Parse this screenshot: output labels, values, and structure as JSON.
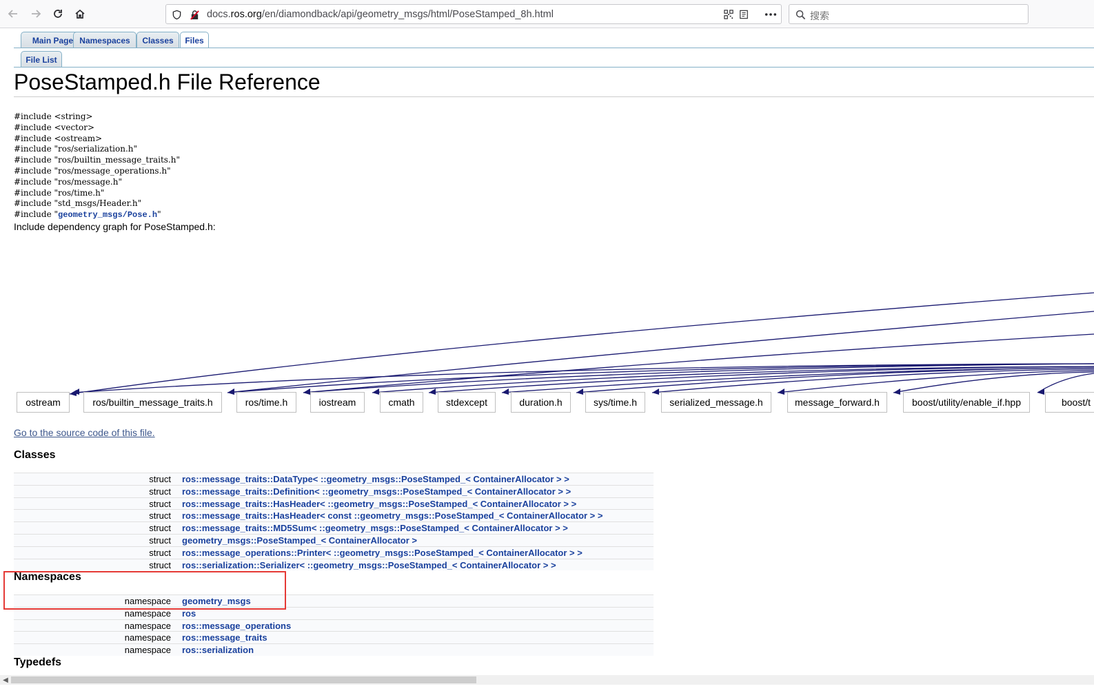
{
  "browser": {
    "url_prefix": "docs.",
    "url_host": "ros.org",
    "url_path": "/en/diamondback/api/geometry_msgs/html/PoseStamped_8h.html",
    "search_placeholder": "搜索",
    "icons": {
      "back": "arrow-left-icon",
      "forward": "arrow-right-icon",
      "reload": "reload-icon",
      "home": "home-icon",
      "shield": "shield-icon",
      "insecure": "insecure-lock-icon",
      "qr": "qr-code-icon",
      "reader": "reader-view-icon",
      "more": "more-icon",
      "search": "search-icon"
    }
  },
  "tabs": {
    "main_page": "Main Page",
    "namespaces": "Namespaces",
    "classes": "Classes",
    "files": "Files",
    "file_list": "File List"
  },
  "title": "PoseStamped.h File Reference",
  "includes": [
    "#include <string>",
    "#include <vector>",
    "#include <ostream>",
    "#include \"ros/serialization.h\"",
    "#include \"ros/builtin_message_traits.h\"",
    "#include \"ros/message_operations.h\"",
    "#include \"ros/message.h\"",
    "#include \"ros/time.h\"",
    "#include \"std_msgs/Header.h\""
  ],
  "include_link_prefix": "#include \"",
  "include_link": "geometry_msgs/Pose.h",
  "include_link_suffix": "\"",
  "dep_caption": "Include dependency graph for PoseStamped.h:",
  "graph_nodes": [
    "ostream",
    "ros/builtin_message_traits.h",
    "ros/time.h",
    "iostream",
    "cmath",
    "stdexcept",
    "duration.h",
    "sys/time.h",
    "serialized_message.h",
    "message_forward.h",
    "boost/utility/enable_if.hpp",
    "boost/t"
  ],
  "source_link": "Go to the source code of this file.",
  "sections": {
    "classes": "Classes",
    "namespaces": "Namespaces",
    "typedefs": "Typedefs"
  },
  "classes": [
    {
      "kind": "struct",
      "name": "ros::message_traits::DataType< ::geometry_msgs::PoseStamped_< ContainerAllocator > >"
    },
    {
      "kind": "struct",
      "name": "ros::message_traits::Definition< ::geometry_msgs::PoseStamped_< ContainerAllocator > >"
    },
    {
      "kind": "struct",
      "name": "ros::message_traits::HasHeader< ::geometry_msgs::PoseStamped_< ContainerAllocator > >"
    },
    {
      "kind": "struct",
      "name": "ros::message_traits::HasHeader< const ::geometry_msgs::PoseStamped_< ContainerAllocator > >"
    },
    {
      "kind": "struct",
      "name": "ros::message_traits::MD5Sum< ::geometry_msgs::PoseStamped_< ContainerAllocator > >"
    },
    {
      "kind": "struct",
      "name": "geometry_msgs::PoseStamped_< ContainerAllocator >"
    },
    {
      "kind": "struct",
      "name": "ros::message_operations::Printer< ::geometry_msgs::PoseStamped_< ContainerAllocator > >"
    },
    {
      "kind": "struct",
      "name": "ros::serialization::Serializer< ::geometry_msgs::PoseStamped_< ContainerAllocator > >"
    }
  ],
  "namespaces": [
    {
      "kind": "namespace",
      "name": "geometry_msgs"
    },
    {
      "kind": "namespace",
      "name": "ros"
    },
    {
      "kind": "namespace",
      "name": "ros::message_operations"
    },
    {
      "kind": "namespace",
      "name": "ros::message_traits"
    },
    {
      "kind": "namespace",
      "name": "ros::serialization"
    }
  ],
  "colors": {
    "link": "#1a419d",
    "graph_edge": "#191970",
    "highlight": "#e53935"
  }
}
